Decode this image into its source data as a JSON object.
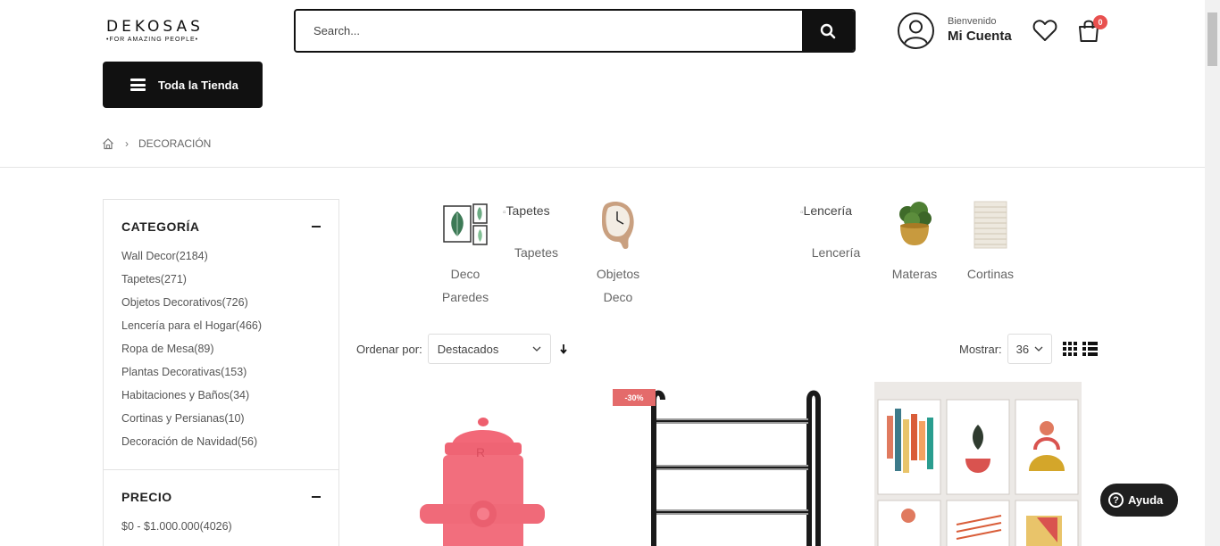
{
  "header": {
    "logo_main": "DEKOSAS",
    "logo_sub": "•FOR AMAZING PEOPLE•",
    "search_placeholder": "Search...",
    "account_greeting": "Bienvenido",
    "account_label": "Mi Cuenta",
    "cart_count": "0",
    "store_button": "Toda la Tienda"
  },
  "breadcrumb": {
    "current": "DECORACIÓN"
  },
  "sidebar": {
    "category_title": "CATEGORÍA",
    "categories": [
      "Wall Decor(2184)",
      "Tapetes(271)",
      "Objetos Decorativos(726)",
      "Lencería para el Hogar(466)",
      "Ropa de Mesa(89)",
      "Plantas Decorativas(153)",
      "Habitaciones y Baños(34)",
      "Cortinas y Persianas(10)",
      "Decoración de Navidad(56)"
    ],
    "price_title": "PRECIO",
    "price_ranges": [
      "$0 - $1.000.000(4026)"
    ]
  },
  "category_icons": [
    {
      "label": "Deco Paredes",
      "icon": "wall-frames-icon"
    },
    {
      "label": "Tapetes",
      "alt": "Tapetes",
      "icon": "broken-image-icon"
    },
    {
      "label": "Objetos Deco",
      "icon": "melting-clock-icon"
    },
    {
      "label": "Lencería",
      "alt": "Lencería",
      "icon": "broken-image-icon"
    },
    {
      "label": "Materas",
      "icon": "plant-pot-icon"
    },
    {
      "label": "Cortinas",
      "icon": "blind-icon"
    }
  ],
  "sort": {
    "label": "Ordenar por:",
    "value": "Destacados"
  },
  "show": {
    "label": "Mostrar:",
    "value": "36"
  },
  "products": [
    {
      "badge": ""
    },
    {
      "badge": "-30%"
    },
    {
      "badge": ""
    }
  ],
  "help": {
    "label": "Ayuda"
  }
}
